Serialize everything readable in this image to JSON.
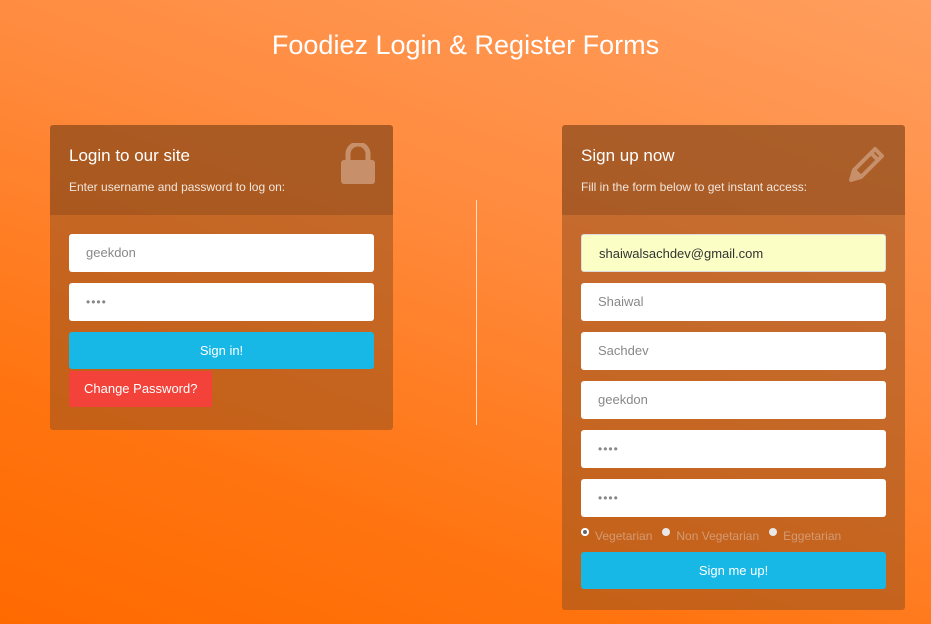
{
  "page": {
    "title": "Foodiez Login & Register Forms"
  },
  "login": {
    "title": "Login to our site",
    "subtitle": "Enter username and password to log on:",
    "icon": "lock-icon",
    "username_value": "geekdon",
    "password_value": "••••",
    "signin_label": "Sign in!",
    "change_password_label": "Change Password?"
  },
  "signup": {
    "title": "Sign up now",
    "subtitle": "Fill in the form below to get instant access:",
    "icon": "pencil-icon",
    "email_value": "shaiwalsachdev@gmail.com",
    "first_name_value": "Shaiwal",
    "last_name_value": "Sachdev",
    "username_value": "geekdon",
    "password_value": "••••",
    "confirm_password_value": "••••",
    "diet_options": [
      "Vegetarian",
      "Non Vegetarian",
      "Eggetarian"
    ],
    "diet_selected": "Vegetarian",
    "signup_label": "Sign me up!"
  },
  "colors": {
    "primary_button": "#17b8e6",
    "danger_button": "#f2423a",
    "autofill_highlight": "#fbffc6"
  }
}
